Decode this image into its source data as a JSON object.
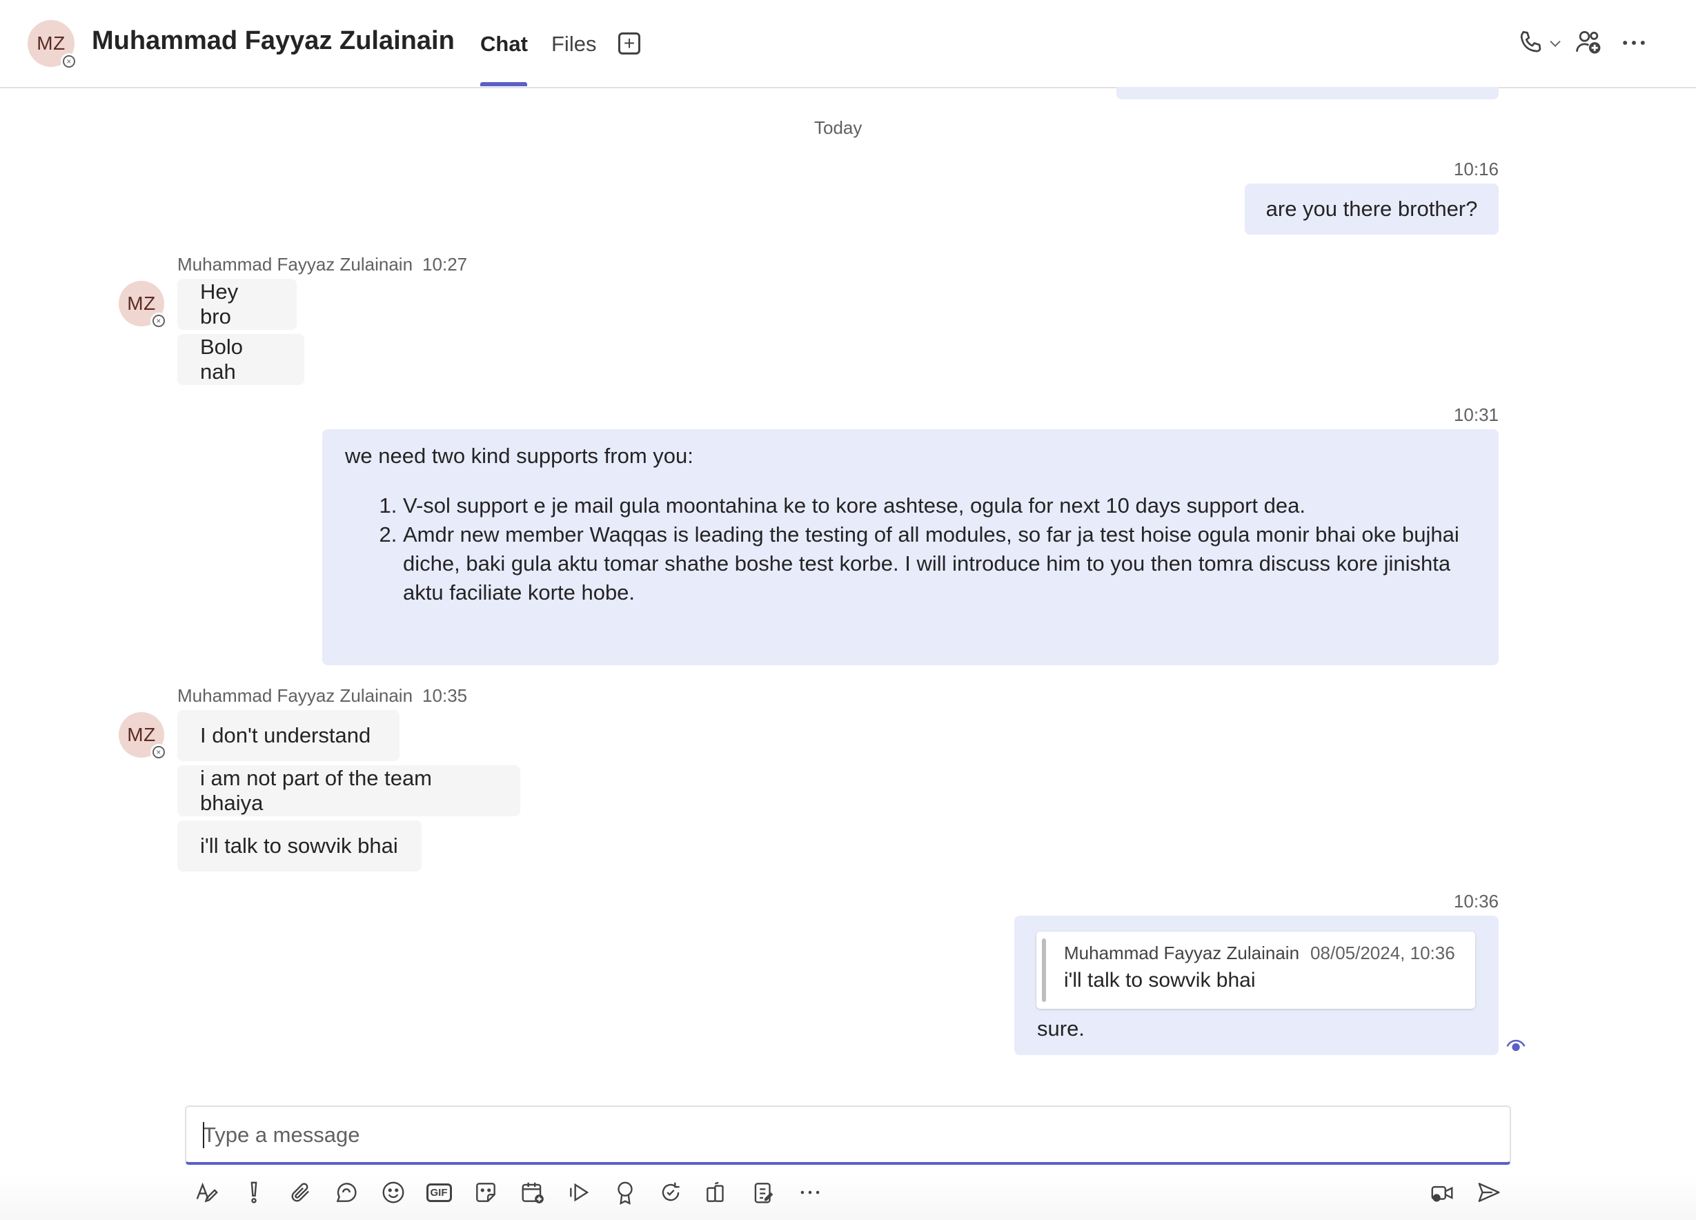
{
  "header": {
    "avatar_initials": "MZ",
    "title": "Muhammad Fayyaz Zulainain",
    "tabs": [
      {
        "label": "Chat",
        "active": true
      },
      {
        "label": "Files",
        "active": false
      }
    ],
    "icons": [
      "add-tab-icon",
      "phone-icon",
      "chevron-down-icon",
      "add-people-icon",
      "more-icon"
    ]
  },
  "chat": {
    "day_separator": "Today",
    "messages": [
      {
        "direction": "out",
        "time": "10:16",
        "text": "are you there brother?"
      },
      {
        "direction": "in",
        "sender": "Muhammad Fayyaz Zulainain",
        "time": "10:27",
        "avatar": "MZ",
        "lines": [
          "Hey bro",
          "Bolo nah"
        ]
      },
      {
        "direction": "out",
        "time": "10:31",
        "intro": "we need two kind supports from you:",
        "list": [
          "V-sol support e je mail gula moontahina ke to kore ashtese, ogula for next 10 days support dea.",
          "Amdr new member Waqqas is leading the testing of all modules, so far ja test hoise ogula monir bhai oke bujhai diche, baki gula aktu tomar shathe boshe test korbe. I will introduce him to you then tomra discuss kore jinishta aktu faciliate korte hobe."
        ]
      },
      {
        "direction": "in",
        "sender": "Muhammad Fayyaz Zulainain",
        "time": "10:35",
        "avatar": "MZ",
        "lines": [
          "I don't understand",
          "i am not part of the team bhaiya",
          "i'll talk to sowvik bhai"
        ]
      },
      {
        "direction": "out",
        "time": "10:36",
        "quote": {
          "sender": "Muhammad Fayyaz Zulainain",
          "timestamp": "08/05/2024, 10:36",
          "text": "i'll talk to sowvik bhai"
        },
        "text": "sure."
      }
    ]
  },
  "compose": {
    "placeholder": "Type a message",
    "toolbar": [
      "format-icon",
      "important-icon",
      "attach-icon",
      "loop-icon",
      "emoji-icon",
      "gif-icon",
      "sticker-icon",
      "schedule-meeting-icon",
      "stream-icon",
      "praise-icon",
      "update-icon",
      "apps-icon",
      "clipboard-icon",
      "more-options-icon",
      "video-message-icon",
      "send-icon"
    ],
    "gif_label": "GIF"
  },
  "colors": {
    "accent": "#5b5fc7",
    "outgoing_bubble": "#e8ebfa",
    "incoming_bubble": "#f5f5f5",
    "avatar_bg": "#f0d6d0"
  }
}
